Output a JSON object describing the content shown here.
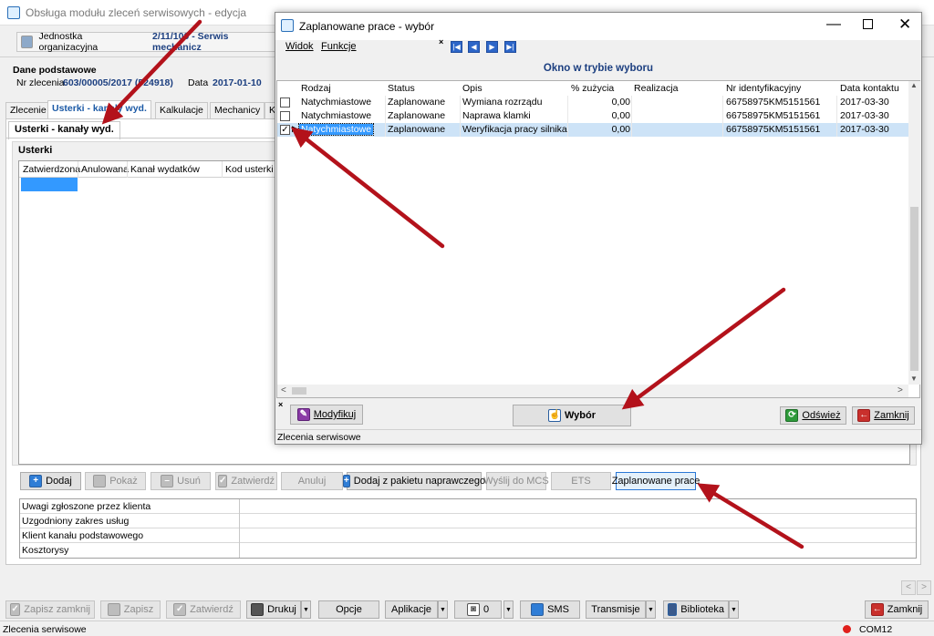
{
  "main": {
    "title": "Obsługa modułu zleceń serwisowych - edycja",
    "org_label": "Jednostka organizacyjna",
    "org_value": "2/11/100 - Serwis mechanicz",
    "section_title": "Dane podstawowe",
    "order_label": "Nr zlecenia",
    "order_value": "603/00005/2017 (524918)",
    "date_label": "Data",
    "date_value": "2017-01-10",
    "tabs": [
      "Zlecenie",
      "Usterki - kanały wyd.",
      "Kalkulacje",
      "Mechanicy",
      "K"
    ],
    "subtab": "Usterki - kanały wyd.",
    "group_title": "Usterki",
    "columns": [
      "Zatwierdzona",
      "Anulowana",
      "Kanał wydatków",
      "Kod usterki"
    ],
    "buttons": [
      "Dodaj",
      "Pokaż",
      "Usuń",
      "Zatwierdź",
      "Anuluj",
      "Dodaj z pakietu naprawczego",
      "Wyślij do MCS",
      "ETS",
      "Zaplanowane prace"
    ],
    "info_rows": [
      "Uwagi zgłoszone przez klienta",
      "Uzgodniony zakres usług",
      "Klient kanału podstawowego",
      "Kosztorysy"
    ],
    "bottom_buttons": [
      "Zapisz zamknij",
      "Zapisz",
      "Zatwierdź",
      "Drukuj",
      "Opcje",
      "Aplikacje",
      "0",
      "SMS",
      "Transmisje",
      "Biblioteka",
      "Zamknij"
    ],
    "status_left": "Zlecenia serwisowe",
    "status_right": "COM12"
  },
  "dialog": {
    "title": "Zaplanowane prace - wybór",
    "menu": [
      "Widok",
      "Funkcje"
    ],
    "subtitle": "Okno w trybie wyboru",
    "columns": [
      "Rodzaj",
      "Status",
      "Opis",
      "% zużycia",
      "Realizacja",
      "Nr identyfikacyjny",
      "Data kontaktu"
    ],
    "rows": [
      {
        "checked": false,
        "rodzaj": "Natychmiastowe",
        "status": "Zaplanowane",
        "opis": "Wymiana rozrządu",
        "zuzycie": "0,00",
        "realizacja": "",
        "nr": "66758975KM5151561",
        "data": "2017-03-30"
      },
      {
        "checked": false,
        "rodzaj": "Natychmiastowe",
        "status": "Zaplanowane",
        "opis": "Naprawa klamki",
        "zuzycie": "0,00",
        "realizacja": "",
        "nr": "66758975KM5151561",
        "data": "2017-03-30"
      },
      {
        "checked": true,
        "rodzaj": "Natychmiastowe",
        "status": "Zaplanowane",
        "opis": "Weryfikacja pracy silnika",
        "zuzycie": "0,00",
        "realizacja": "",
        "nr": "66758975KM5151561",
        "data": "2017-03-30"
      }
    ],
    "btn_modify": "Modyfikuj",
    "btn_select": "Wybór",
    "btn_refresh": "Odśwież",
    "btn_close": "Zamknij",
    "status": "Zlecenia serwisowe"
  },
  "colors": {
    "accent": "#1c5aa6",
    "selection": "#3399ff",
    "annotation": "#b3121b"
  }
}
